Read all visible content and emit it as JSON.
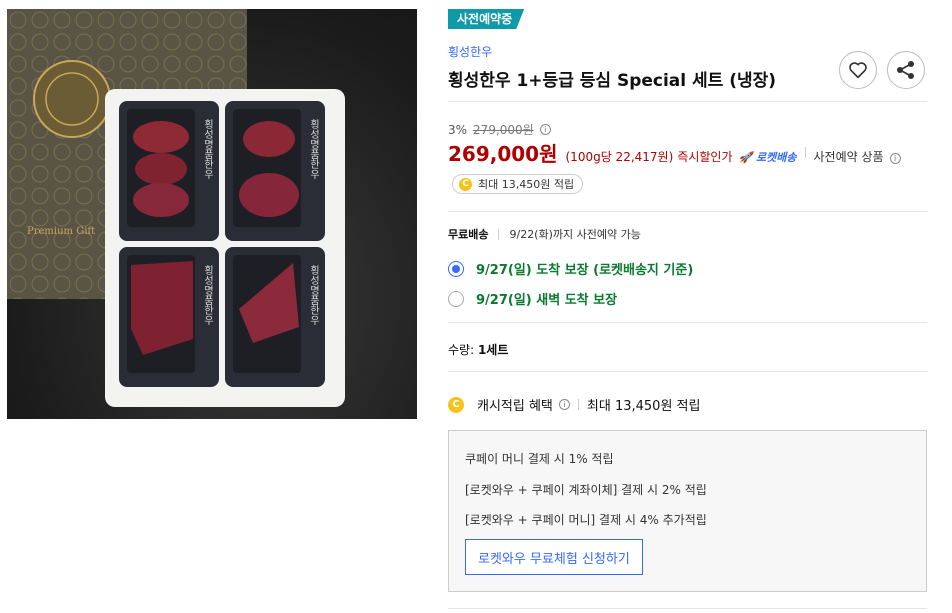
{
  "badge": "사전예약중",
  "brand": "횡성한우",
  "title": "횡성한우 1+등급 등심 Special 세트 (냉장)",
  "icons": {
    "favorite": "heart-icon",
    "share": "share-icon"
  },
  "price": {
    "discount_rate": "3%",
    "original_price": "279,000원",
    "sale_price": "269,000원",
    "unit_price": "(100g당 22,417원)",
    "instant_discount": "즉시할인가",
    "rocket_label": "로켓배송",
    "preorder_label": "사전예약 상품"
  },
  "cash_pill": {
    "coin": "C",
    "text": "최대 13,450원 적립"
  },
  "shipping": {
    "label": "무료배송",
    "note": "9/22(화)까지 사전예약 가능",
    "options": [
      {
        "label": "9/27(일) 도착 보장 (로켓배송지 기준)",
        "selected": true
      },
      {
        "label": "9/27(일) 새벽 도착 보장",
        "selected": false
      }
    ]
  },
  "quantity": {
    "label": "수량:",
    "value": "1세트"
  },
  "benefit": {
    "coin": "C",
    "label": "캐시적립 혜택",
    "value": "최대 13,450원 적립"
  },
  "benefit_box": {
    "lines": [
      "쿠페이 머니 결제 시 1% 적립",
      "[로켓와우 + 쿠페이 계좌이체] 결제 시 2% 적립",
      "[로켓와우 + 쿠페이 머니] 결제 시 4% 추가적립"
    ],
    "cta": "로켓와우 무료체험 신청하기"
  },
  "image": {
    "tray_label": "횡성명품한우",
    "box_text": "Premium Gift"
  },
  "colors": {
    "accent": "#346aff",
    "price_red": "#ae0000",
    "badge": "#0f9aa8",
    "green": "#0a7a2f"
  }
}
